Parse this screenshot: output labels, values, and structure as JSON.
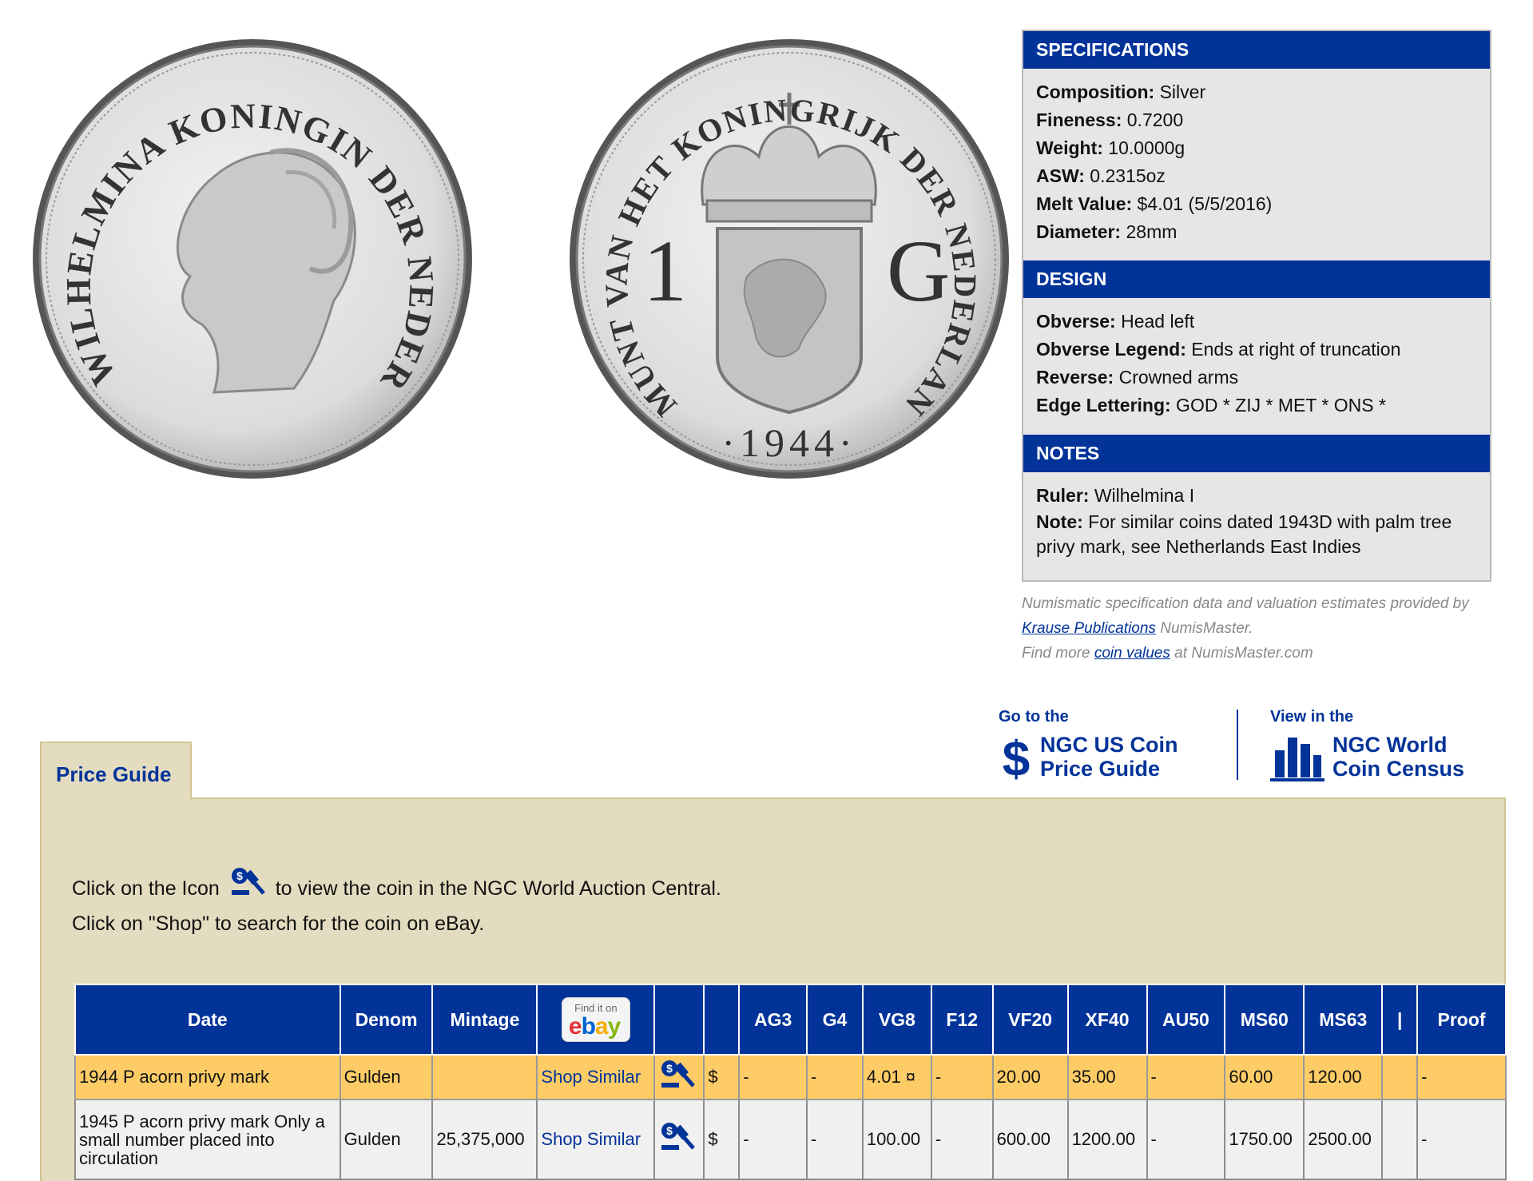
{
  "specifications": {
    "heading": "SPECIFICATIONS",
    "rows": [
      {
        "label": "Composition:",
        "value": " Silver"
      },
      {
        "label": "Fineness:",
        "value": " 0.7200"
      },
      {
        "label": "Weight:",
        "value": " 10.0000g"
      },
      {
        "label": "ASW:",
        "value": " 0.2315oz"
      },
      {
        "label": "Melt Value:",
        "value": " $4.01 (5/5/2016)"
      },
      {
        "label": "Diameter:",
        "value": " 28mm"
      }
    ]
  },
  "design": {
    "heading": "DESIGN",
    "rows": [
      {
        "label": "Obverse:",
        "value": " Head left"
      },
      {
        "label": "Obverse Legend:",
        "value": " Ends at right of truncation"
      },
      {
        "label": "Reverse:",
        "value": " Crowned arms"
      },
      {
        "label": "Edge Lettering:",
        "value": " GOD * ZIJ * MET * ONS *"
      }
    ]
  },
  "notes": {
    "heading": "NOTES",
    "rows": [
      {
        "label": "Ruler:",
        "value": " Wilhelmina I"
      },
      {
        "label": "Note:",
        "value": "  For similar coins dated 1943D with palm tree privy mark, see Netherlands East Indies"
      }
    ]
  },
  "credits": {
    "line1": "Numismatic specification data and valuation estimates provided by",
    "krause_link": "Krause Publications",
    "line2_suffix": " NumisMaster.",
    "line3_prefix": "Find more ",
    "coin_values_link": "coin values",
    "line3_suffix": " at NumisMaster.com"
  },
  "links": {
    "us_small": "Go to the",
    "us_big1": "NGC US Coin",
    "us_big2": "Price Guide",
    "world_small": "View in the",
    "world_big1": "NGC World",
    "world_big2": "Coin Census"
  },
  "price_guide": {
    "tab_label": "Price Guide",
    "instr1_before": "Click on the Icon",
    "instr1_after": "to view the coin in the NGC World Auction Central.",
    "instr2": "Click on \"Shop\" to search for the coin on eBay.",
    "columns": [
      "Date",
      "Denom",
      "Mintage",
      "",
      "",
      "",
      "AG3",
      "G4",
      "VG8",
      "F12",
      "VF20",
      "XF40",
      "AU50",
      "MS60",
      "MS63",
      "|",
      "Proof"
    ],
    "ebay_find": "Find it on",
    "rows": [
      {
        "date": "1944 P acorn privy mark",
        "denom": "Gulden",
        "mintage": "",
        "shop": "Shop Similar",
        "cur": "$",
        "ag3": "-",
        "g4": "-",
        "vg8": "4.01 ¤",
        "f12": "-",
        "vf20": "20.00",
        "xf40": "35.00",
        "au50": "-",
        "ms60": "60.00",
        "ms63": "120.00",
        "sep": "",
        "proof": "-"
      },
      {
        "date": "1945 P acorn privy mark Only a small number placed into circulation",
        "denom": "Gulden",
        "mintage": "25,375,000",
        "shop": "Shop Similar",
        "cur": "$",
        "ag3": "-",
        "g4": "-",
        "vg8": "100.00",
        "f12": "-",
        "vf20": "600.00",
        "xf40": "1200.00",
        "au50": "-",
        "ms60": "1750.00",
        "ms63": "2500.00",
        "sep": "",
        "proof": "-"
      }
    ]
  },
  "coins": {
    "obverse_legend": "WILHELMINA KONINGIN DER NEDERLANDEN",
    "reverse_legend": "MUNT VAN HET KONINGRIJK DER NEDERLANDEN",
    "reverse_denom_left": "1",
    "reverse_denom_right": "G",
    "reverse_date": "·1944·"
  },
  "colors": {
    "brand_blue": "#013399",
    "tan": "#e4dcc0",
    "row_highlight": "#fdcc66"
  }
}
